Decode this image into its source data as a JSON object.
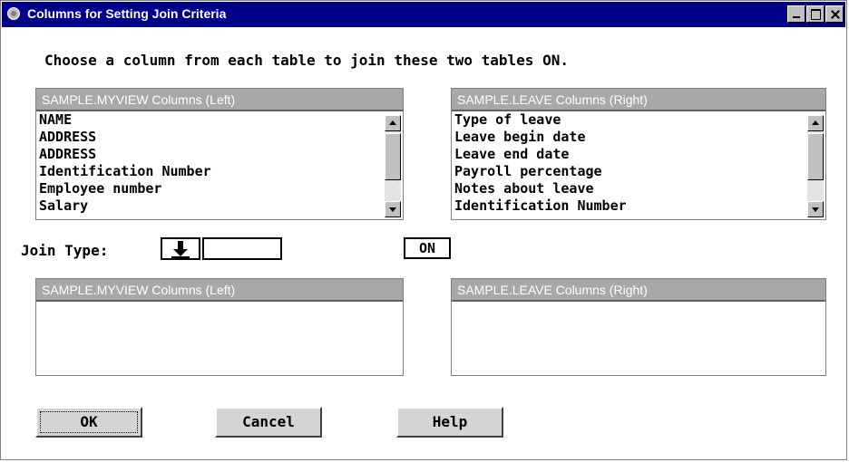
{
  "window": {
    "title": "Columns for Setting Join Criteria",
    "controls": [
      "minimize",
      "maximize",
      "close"
    ]
  },
  "prompt": "Choose a column from each table to join these two tables ON.",
  "left_list": {
    "header": "SAMPLE.MYVIEW Columns (Left)",
    "items": [
      "NAME",
      "ADDRESS",
      "ADDRESS",
      "Identification Number",
      "Employee number",
      "Salary"
    ]
  },
  "right_list": {
    "header": "SAMPLE.LEAVE Columns (Right)",
    "items": [
      "Type of leave",
      "Leave begin date",
      "Leave end date",
      "Payroll percentage",
      "Notes about leave",
      "Identification Number"
    ]
  },
  "join": {
    "label": "Join Type:",
    "value": "",
    "on_label": "ON"
  },
  "selected_left": {
    "header": "SAMPLE.MYVIEW Columns (Left)"
  },
  "selected_right": {
    "header": "SAMPLE.LEAVE Columns (Right)"
  },
  "buttons": {
    "ok": "OK",
    "cancel": "Cancel",
    "help": "Help"
  },
  "colors": {
    "titlebar": "#00008b",
    "listbox_header": "#a8a8a8",
    "button_face": "#d4d4d4"
  }
}
